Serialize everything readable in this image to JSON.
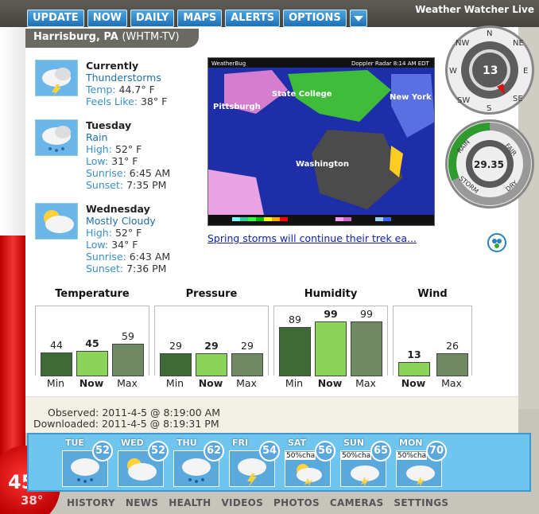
{
  "app": {
    "title": "Weather Watcher Live"
  },
  "nav": [
    "UPDATE",
    "NOW",
    "DAILY",
    "MAPS",
    "ALERTS",
    "OPTIONS"
  ],
  "location": {
    "city": "Harrisburg, PA",
    "station": "(WHTM-TV)"
  },
  "current": {
    "heading": "Currently",
    "condition": "Thunderstorms",
    "temp_label": "Temp:",
    "temp": "44.7° F",
    "feels_label": "Feels Like:",
    "feels": "38° F",
    "icon": "thunderstorm-icon"
  },
  "days": [
    {
      "heading": "Tuesday",
      "condition": "Rain",
      "high_label": "High:",
      "high": "52° F",
      "low_label": "Low:",
      "low": "31° F",
      "sunrise_label": "Sunrise:",
      "sunrise": "6:45 AM",
      "sunset_label": "Sunset:",
      "sunset": "7:35 PM",
      "icon": "rain-icon"
    },
    {
      "heading": "Wednesday",
      "condition": "Mostly Cloudy",
      "high_label": "High:",
      "high": "52° F",
      "low_label": "Low:",
      "low": "34° F",
      "sunrise_label": "Sunrise:",
      "sunrise": "6:43 AM",
      "sunset_label": "Sunset:",
      "sunset": "7:36 PM",
      "icon": "mostly-cloudy-icon"
    }
  ],
  "radar": {
    "brand": "WeatherBug",
    "header": "Doppler Radar  8:14 AM EDT",
    "cities": [
      "Pittsburgh",
      "State College",
      "New York",
      "Washington"
    ],
    "caption": "Spring storms will continue their trek ea..."
  },
  "compass": {
    "labels": [
      "N",
      "NE",
      "E",
      "SE",
      "S",
      "SW",
      "W",
      "NW"
    ],
    "speed": "13"
  },
  "pressure": {
    "value": "29.35",
    "labels": [
      "RAIN",
      "FAIR",
      "STORM",
      "DRY"
    ]
  },
  "gauges": [
    {
      "title": "Temperature",
      "min": "44",
      "now": "45",
      "max": "59",
      "min_f": 0.43,
      "now_f": 0.45,
      "max_f": 0.59
    },
    {
      "title": "Pressure",
      "min": "29",
      "now": "29",
      "max": "29",
      "min_f": 0.42,
      "now_f": 0.42,
      "max_f": 0.42
    },
    {
      "title": "Humidity",
      "min": "89",
      "now": "99",
      "max": "99",
      "min_f": 0.89,
      "now_f": 0.99,
      "max_f": 0.99
    },
    {
      "title": "Wind",
      "now": "13",
      "max": "26",
      "now_f": 0.25,
      "max_f": 0.42
    }
  ],
  "bar_labels": {
    "min": "Min",
    "now": "Now",
    "max": "Max"
  },
  "colors": {
    "min": "#3f6a37",
    "now": "#8ad45a",
    "max": "#6f8a62"
  },
  "observed": {
    "observed": "Observed: 2011-4-5 @ 8:19:00 AM",
    "downloaded": "Downloaded: 2011-4-5 @ 8:19:31 PM"
  },
  "forecast": [
    {
      "day": "TUE",
      "temp": "52",
      "pct": ""
    },
    {
      "day": "WED",
      "temp": "52",
      "pct": ""
    },
    {
      "day": "THU",
      "temp": "62",
      "pct": ""
    },
    {
      "day": "FRI",
      "temp": "54",
      "pct": ""
    },
    {
      "day": "SAT",
      "temp": "56",
      "pct": "50%cha"
    },
    {
      "day": "SUN",
      "temp": "65",
      "pct": "50%cha"
    },
    {
      "day": "MON",
      "temp": "70",
      "pct": "50%cha"
    }
  ],
  "thermometer": {
    "temp": "45°",
    "feels": "38°"
  },
  "bottom_nav": [
    "HISTORY",
    "NEWS",
    "HEALTH",
    "VIDEOS",
    "PHOTOS",
    "CAMERAS",
    "SETTINGS"
  ]
}
